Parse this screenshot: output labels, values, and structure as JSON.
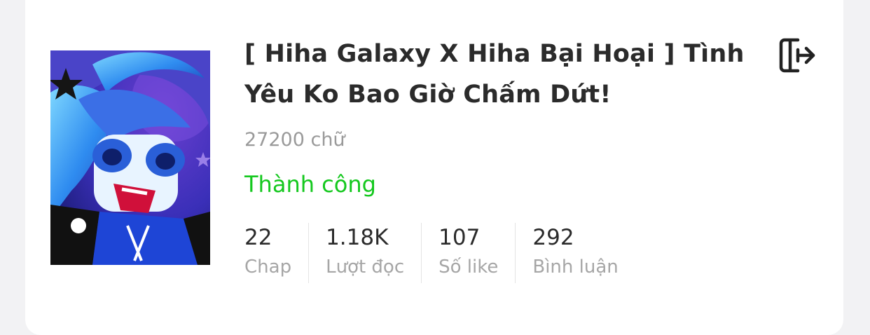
{
  "novel": {
    "title": "[ Hiha Galaxy X Hiha Bại Hoại ] Tình Yêu Ko Bao Giờ Chấm Dứt!",
    "word_count": "27200 chữ",
    "status": "Thành công",
    "status_color": "#14c81e",
    "stats": [
      {
        "value": "22",
        "label": "Chap"
      },
      {
        "value": "1.18K",
        "label": "Lượt đọc"
      },
      {
        "value": "107",
        "label": "Số like"
      },
      {
        "value": "292",
        "label": "Bình luận"
      }
    ],
    "action_icon": "exit-icon"
  }
}
